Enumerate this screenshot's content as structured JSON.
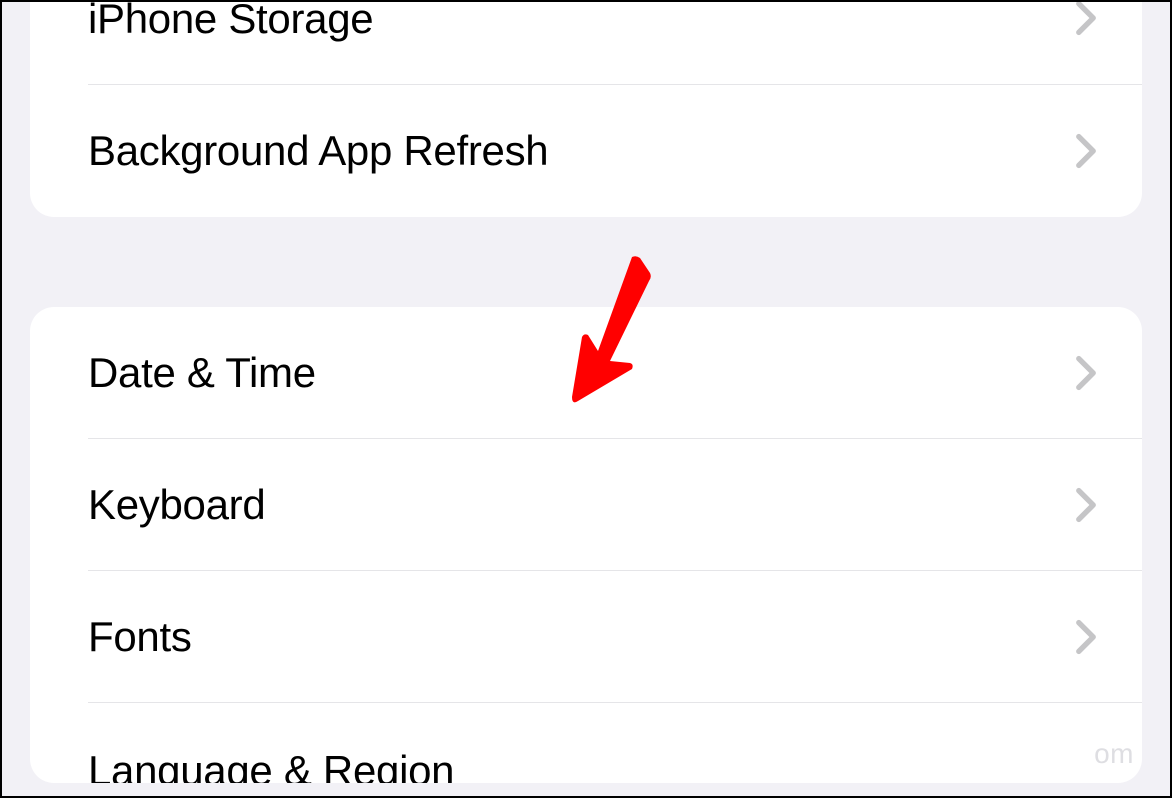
{
  "groups": [
    {
      "rows": [
        {
          "label": "iPhone Storage"
        },
        {
          "label": "Background App Refresh"
        }
      ]
    },
    {
      "rows": [
        {
          "label": "Date & Time"
        },
        {
          "label": "Keyboard"
        },
        {
          "label": "Fonts"
        },
        {
          "label": "Language & Region"
        }
      ]
    }
  ],
  "watermark": "om",
  "annotation": {
    "type": "arrow",
    "target": "Date & Time",
    "color": "#ff0000"
  }
}
